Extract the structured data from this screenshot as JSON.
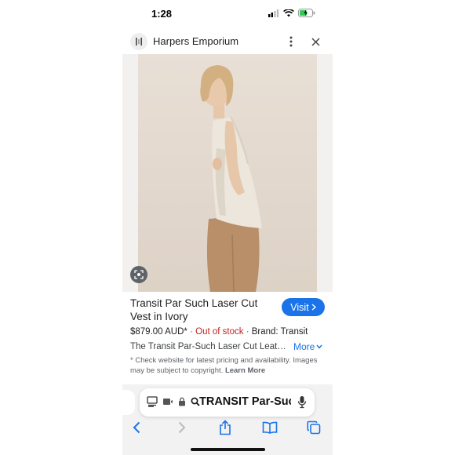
{
  "status_bar": {
    "time": "1:28"
  },
  "header": {
    "site_name": "Harpers Emporium",
    "icons": [
      "site-logo-icon",
      "more-vert-icon",
      "close-icon"
    ]
  },
  "image": {
    "description_icon": "lens-search-icon"
  },
  "product": {
    "title": "Transit Par Such Laser Cut Vest in Ivory",
    "visit_label": "Visit",
    "price": "$879.00 AUD*",
    "separator": "·",
    "stock": "Out of stock",
    "brand": "Brand: Transit",
    "description": "The Transit Par-Such Laser Cut Leath…",
    "more_label": "More",
    "disclaimer": "* Check website for latest pricing and availability. Images may be subject to copyright.",
    "learn_more": "Learn More"
  },
  "address_bar": {
    "query": "TRANSIT Par-Such",
    "icons": [
      "reader-icon",
      "tab-icon",
      "lock-icon",
      "search-icon",
      "mic-icon"
    ]
  },
  "bottom_nav": {
    "icons": [
      "back-icon",
      "forward-icon",
      "share-icon",
      "bookmarks-icon",
      "tabs-icon"
    ]
  },
  "colors": {
    "accent": "#1a73e8",
    "out_of_stock": "#c5221f"
  }
}
